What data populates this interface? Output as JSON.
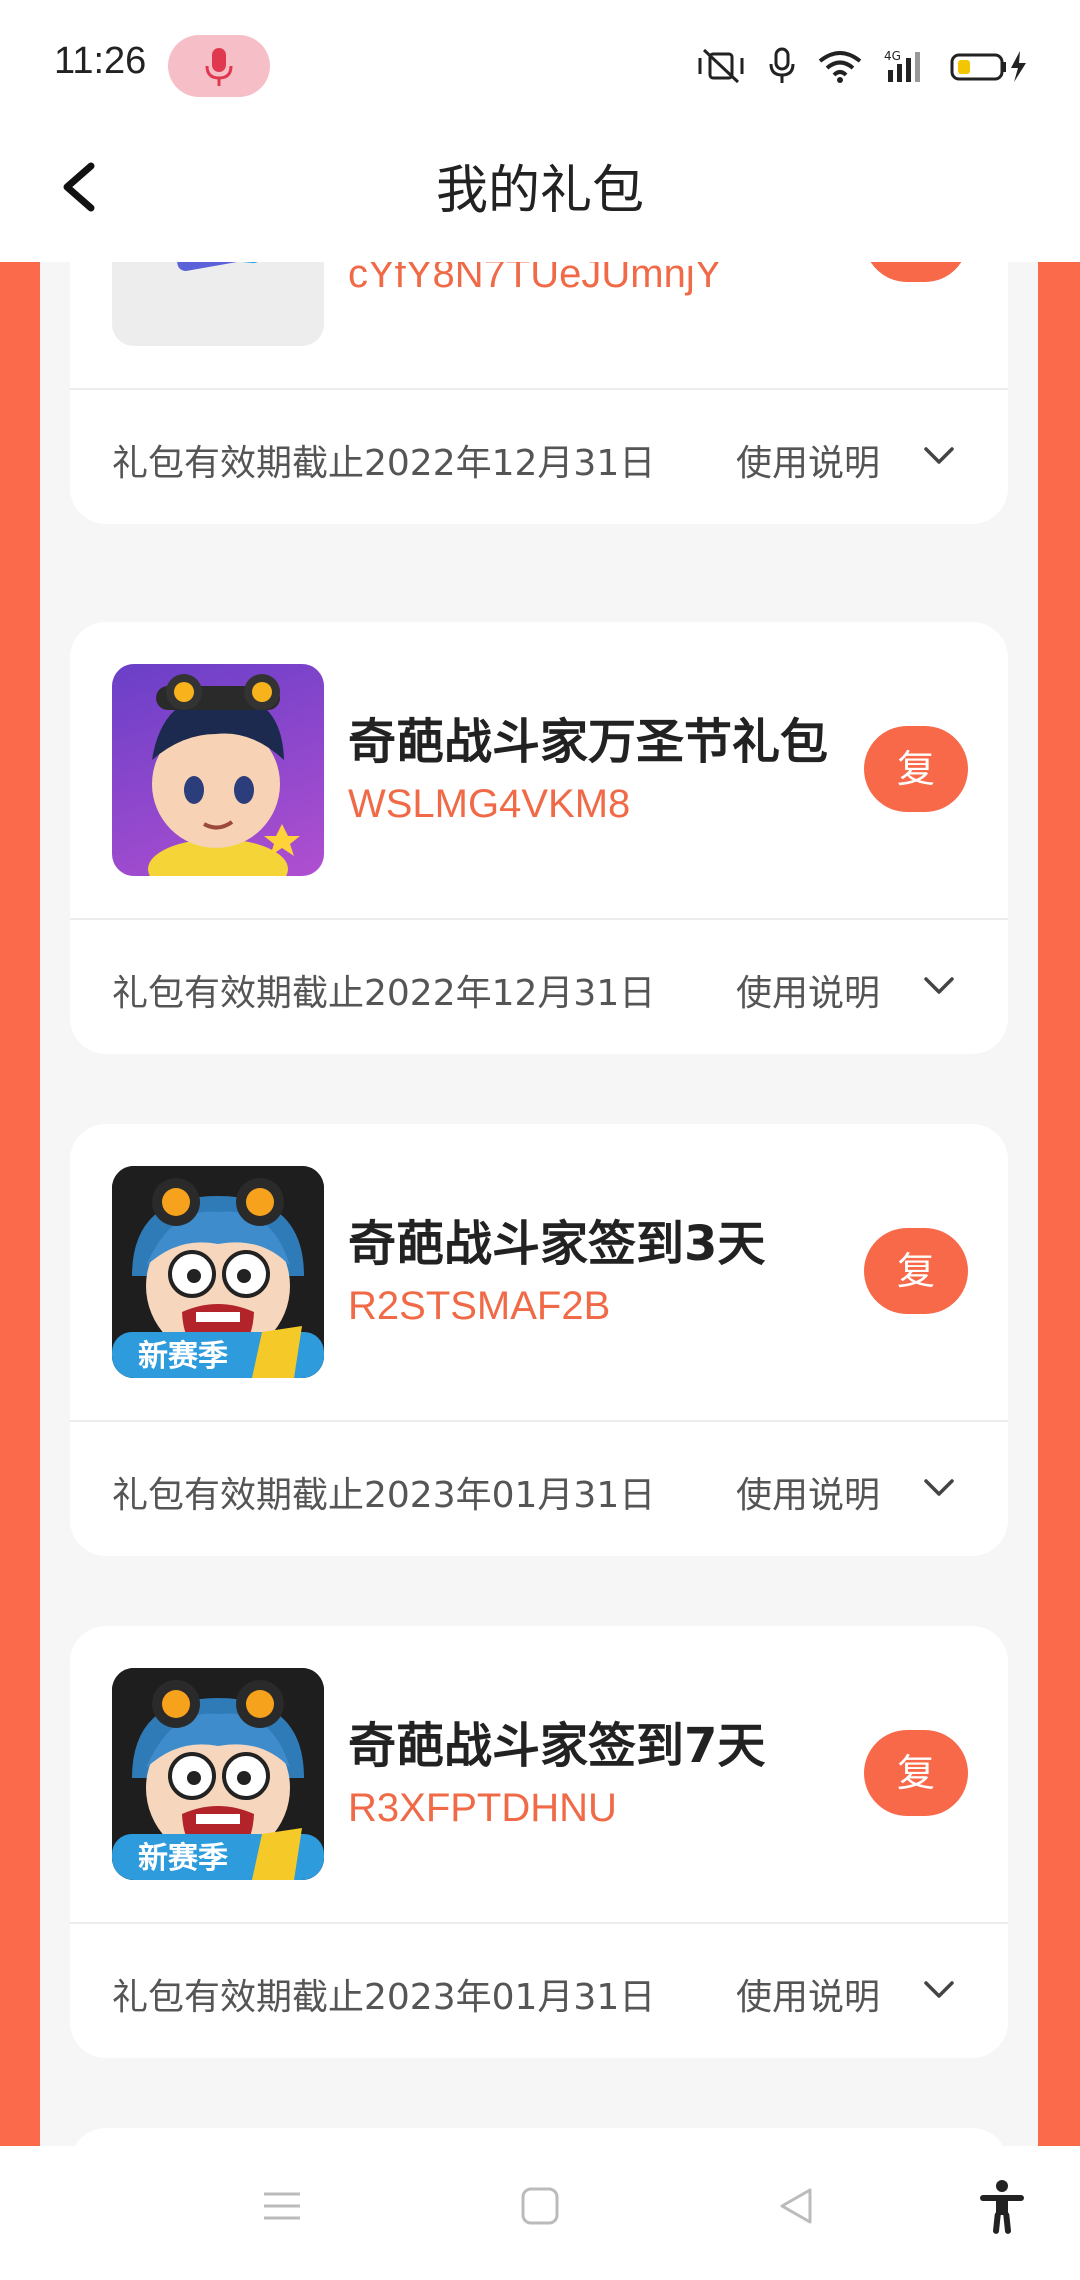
{
  "status": {
    "time": "11:26"
  },
  "header": {
    "title": "我的礼包"
  },
  "gifts": [
    {
      "name": "",
      "code": "cYfY8N7TUeJUmnjY",
      "copy": "复",
      "expiry": "礼包有效期截止2022年12月31日",
      "usage": "使用说明"
    },
    {
      "name": "奇葩战斗家万圣节礼包",
      "code": "WSLMG4VKM8",
      "copy": "复",
      "expiry": "礼包有效期截止2022年12月31日",
      "usage": "使用说明"
    },
    {
      "name": "奇葩战斗家签到3天",
      "code": "R2STSMAF2B",
      "copy": "复",
      "expiry": "礼包有效期截止2023年01月31日",
      "usage": "使用说明"
    },
    {
      "name": "奇葩战斗家签到7天",
      "code": "R3XFPTDHNU",
      "copy": "复",
      "expiry": "礼包有效期截止2023年01月31日",
      "usage": "使用说明"
    }
  ],
  "thumb_badge": "新赛季",
  "colors": {
    "accent": "#fb6a4a",
    "code": "#f06a47",
    "copy_button": "#f8694a"
  }
}
